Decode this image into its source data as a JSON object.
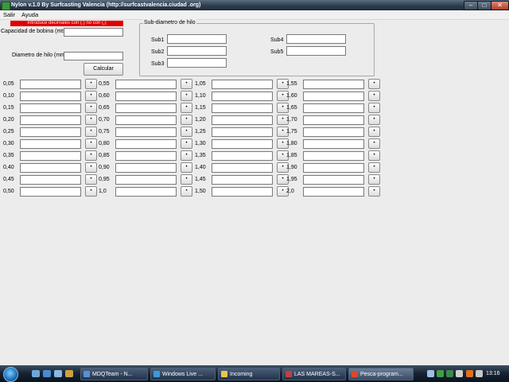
{
  "window": {
    "title": "Nylon v.1.0 By Surfcasting Valencia (http://surfcastvalencia.ciudad .org)",
    "min_glyph": "–",
    "max_glyph": "□",
    "close_glyph": "✕"
  },
  "menu": {
    "items": [
      "Salir",
      "Ayuda"
    ]
  },
  "warning": {
    "text": "Introduce decimales con (.) no con (,)"
  },
  "form": {
    "capacity_label": "Capacidad de bobina (mts)",
    "capacity_value": "",
    "diameter_label": "Diametro de hilo (mm)",
    "diameter_value": "",
    "calc_button": "Calcular"
  },
  "subdiam": {
    "title": "Sub-diametro de hilo",
    "labels": [
      "Sub1",
      "Sub2",
      "Sub3",
      "Sub4",
      "Sub5"
    ],
    "values": [
      "",
      "",
      "",
      "",
      ""
    ]
  },
  "grid": {
    "button_glyph": "•",
    "columns": [
      [
        "0,05",
        "0,10",
        "0,15",
        "0,20",
        "0,25",
        "0,30",
        "0,35",
        "0,40",
        "0,45",
        "0,50"
      ],
      [
        "0,55",
        "0,60",
        "0,65",
        "0,70",
        "0,75",
        "0,80",
        "0,85",
        "0,90",
        "0,95",
        "1,0"
      ],
      [
        "1,05",
        "1,10",
        "1,15",
        "1,20",
        "1,25",
        "1,30",
        "1,35",
        "1,40",
        "1,45",
        "1,50"
      ],
      [
        "1,55",
        "1,60",
        "1,65",
        "1,70",
        "1,75",
        "1,80",
        "1,85",
        "1,90",
        "1,95",
        "2,0"
      ]
    ]
  },
  "taskbar": {
    "tasks": [
      "MDQTeam - N...",
      "Windows Live ...",
      "Incoming",
      "LAS MAREAS-S...",
      "Pesca-program..."
    ],
    "task_colors": [
      "#5a8fd8",
      "#3c9ad8",
      "#e8c84a",
      "#c04040",
      "#d84a2a"
    ],
    "clock": "13:16"
  },
  "colors": {
    "warning_bg": "#e00000",
    "window_bg": "#ececec",
    "titlebar": "#2d3c4e"
  }
}
